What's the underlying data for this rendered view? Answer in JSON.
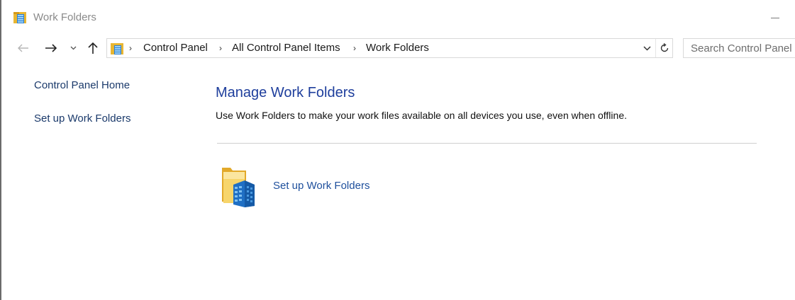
{
  "window": {
    "title": "Work Folders",
    "icon": "work-folders-icon"
  },
  "nav": {
    "back_icon": "back-arrow-icon",
    "forward_icon": "forward-arrow-icon",
    "recent_icon": "chevron-down-icon",
    "up_icon": "up-arrow-icon"
  },
  "address": {
    "icon": "control-panel-icon",
    "segments": [
      "Control Panel",
      "All Control Panel Items",
      "Work Folders"
    ],
    "separator": "›"
  },
  "search": {
    "placeholder": "Search Control Panel"
  },
  "sidebar": {
    "items": [
      {
        "label": "Control Panel Home"
      },
      {
        "label": "Set up Work Folders"
      }
    ]
  },
  "main": {
    "title": "Manage Work Folders",
    "description": "Use Work Folders to make your work files available on all devices you use, even when offline.",
    "action": {
      "label": "Set up Work Folders",
      "icon": "work-folders-large-icon"
    }
  },
  "colors": {
    "link": "#1e4f9c",
    "title": "#1e3e9c",
    "folder_yellow": "#f5c84c",
    "building_blue": "#2a7fd4"
  }
}
